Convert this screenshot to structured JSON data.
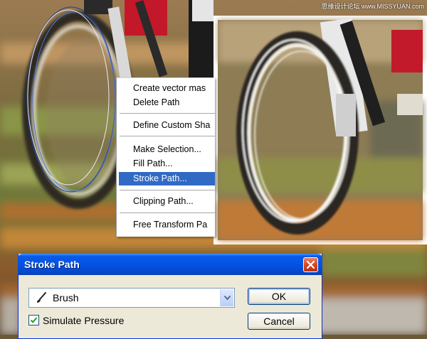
{
  "watermark": "思缘设计论坛 www.MISSYUAN.com",
  "context_menu": {
    "items": [
      {
        "label": "Create vector mas",
        "selected": false
      },
      {
        "label": "Delete Path",
        "selected": false
      },
      {
        "label": "Define Custom Sha",
        "selected": false
      },
      {
        "label": "Make Selection...",
        "selected": false
      },
      {
        "label": "Fill Path...",
        "selected": false
      },
      {
        "label": "Stroke Path...",
        "selected": true
      },
      {
        "label": "Clipping Path...",
        "selected": false
      },
      {
        "label": "Free Transform Pa",
        "selected": false
      }
    ]
  },
  "dialog": {
    "title": "Stroke Path",
    "tool_select": {
      "value": "Brush",
      "icon": "brush-icon"
    },
    "simulate_pressure": {
      "label": "Simulate Pressure",
      "checked": true
    },
    "ok_label": "OK",
    "cancel_label": "Cancel",
    "close_icon": "close-icon"
  },
  "colors": {
    "menu_highlight": "#316ac5",
    "titlebar": "#0453e4",
    "dialog_bg": "#ece9d8",
    "close_button": "#d2461f"
  }
}
